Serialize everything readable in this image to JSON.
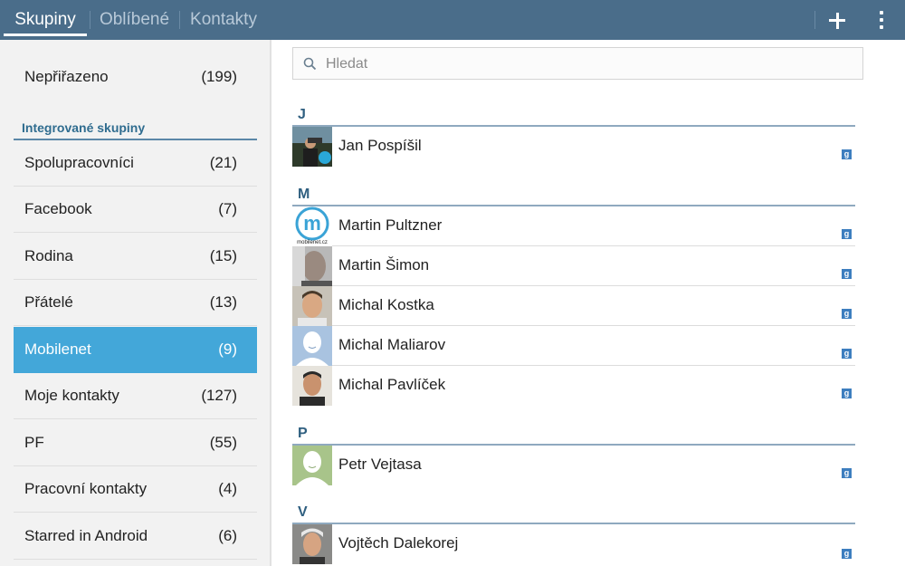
{
  "tabs": [
    {
      "label": "Skupiny"
    },
    {
      "label": "Oblíbené"
    },
    {
      "label": "Kontakty"
    }
  ],
  "groups_top": {
    "name": "Nepřiřazeno",
    "count": "(199)"
  },
  "integrated_header": "Integrované skupiny",
  "groups": [
    {
      "name": "Spolupracovníci",
      "count": "(21)"
    },
    {
      "name": "Facebook",
      "count": "(7)"
    },
    {
      "name": "Rodina",
      "count": "(15)"
    },
    {
      "name": "Přátelé",
      "count": "(13)"
    },
    {
      "name": "Mobilenet",
      "count": "(9)"
    },
    {
      "name": "Moje kontakty",
      "count": "(127)"
    },
    {
      "name": "PF",
      "count": "(55)"
    },
    {
      "name": "Pracovní kontakty",
      "count": "(4)"
    },
    {
      "name": "Starred in Android",
      "count": "(6)"
    }
  ],
  "search": {
    "placeholder": "Hledat"
  },
  "sections": [
    {
      "letter": "J",
      "contacts": [
        {
          "name": "Jan Pospíšil"
        }
      ]
    },
    {
      "letter": "M",
      "contacts": [
        {
          "name": "Martin Pultzner"
        },
        {
          "name": "Martin Šimon"
        },
        {
          "name": "Michal Kostka"
        },
        {
          "name": "Michal Maliarov"
        },
        {
          "name": "Michal Pavlíček"
        }
      ]
    },
    {
      "letter": "P",
      "contacts": [
        {
          "name": "Petr Vejtasa"
        }
      ]
    },
    {
      "letter": "V",
      "contacts": [
        {
          "name": "Vojtěch Dalekorej"
        }
      ]
    }
  ],
  "avatar_logo_text": "mobilenet.cz",
  "avatar_logo_letter": "m",
  "account_badge": "g",
  "colors": {
    "topbar": "#4a6d8a",
    "selected_group": "#43a7d9",
    "section_header": "#2f6c8f"
  }
}
